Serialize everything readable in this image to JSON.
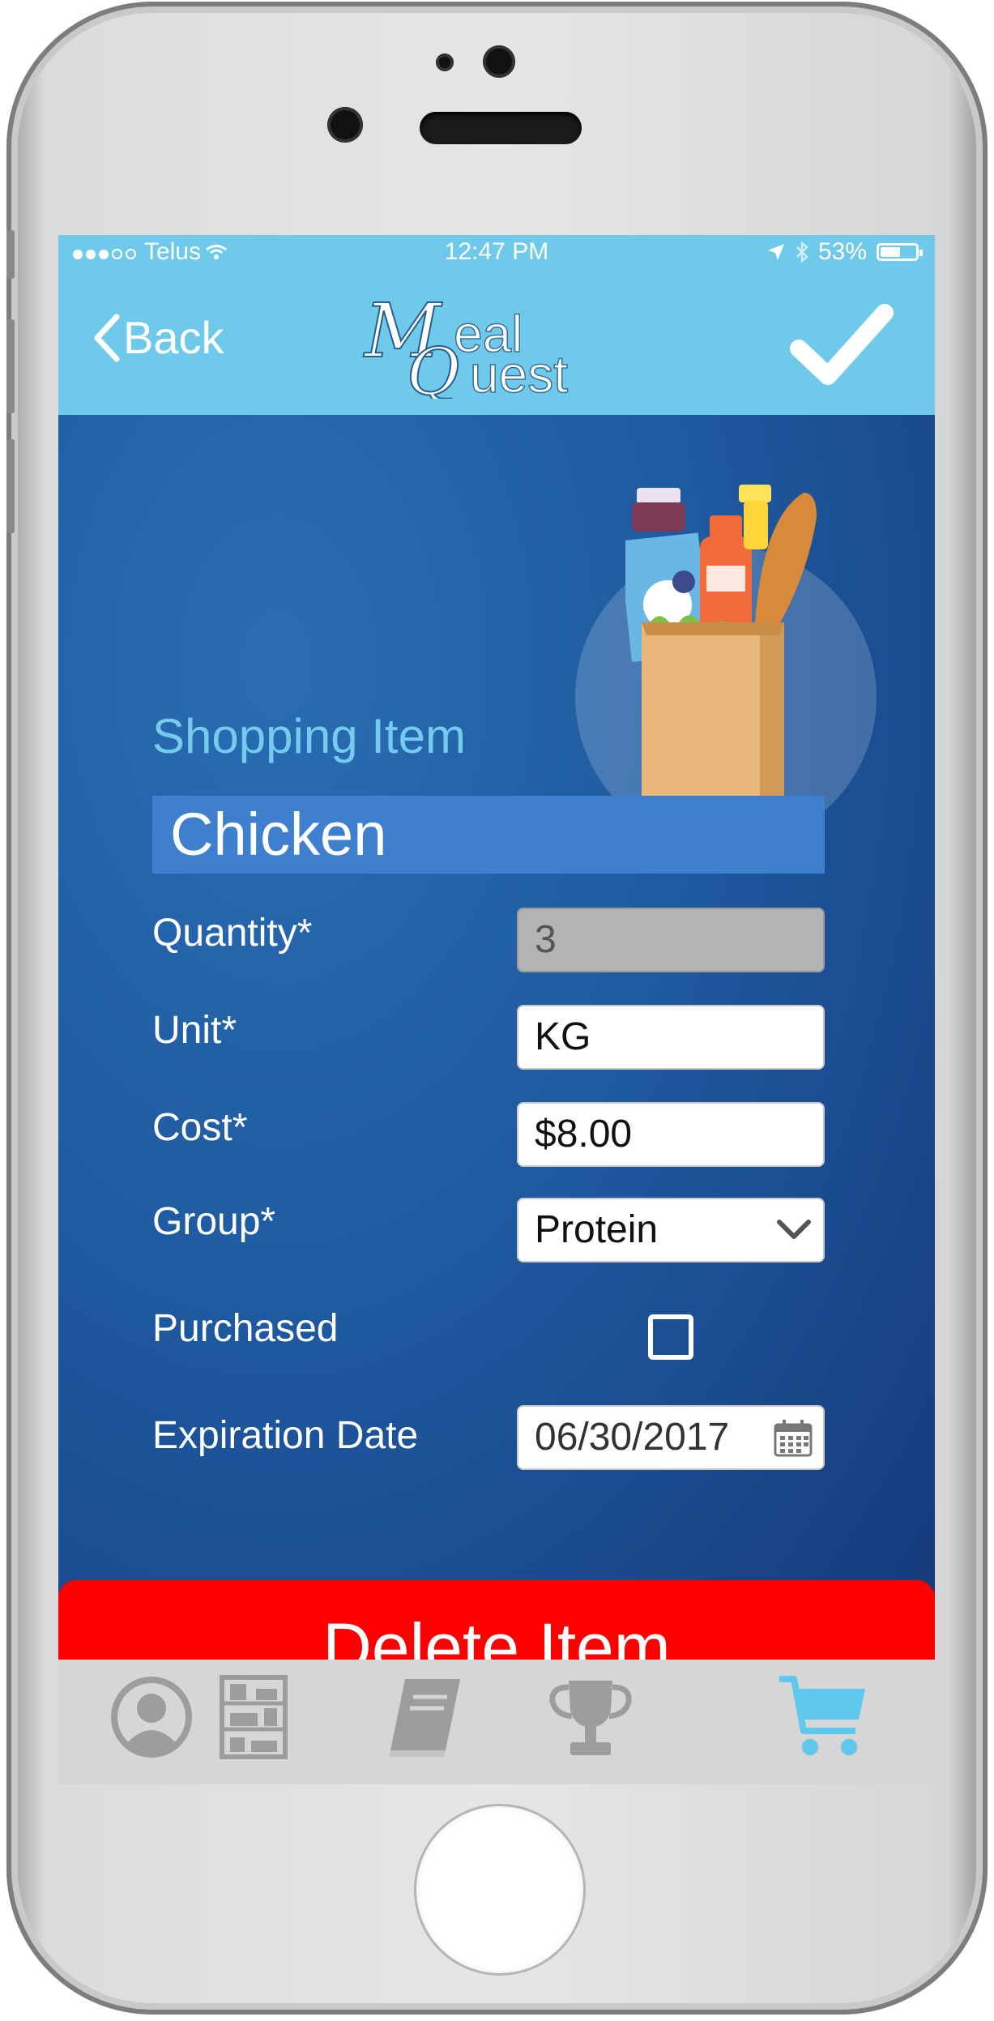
{
  "status_bar": {
    "carrier": "Telus",
    "time": "12:47 PM",
    "battery": "53%"
  },
  "nav": {
    "back_label": "Back",
    "logo_text_top": "eal",
    "logo_text_bottom": "uest",
    "logo_initial_1": "M",
    "logo_initial_2": "Q"
  },
  "form": {
    "section_title": "Shopping Item",
    "item_name": "Chicken",
    "fields": [
      {
        "label": "Quantity*",
        "value": "3"
      },
      {
        "label": "Unit*",
        "value": "KG"
      },
      {
        "label": "Cost*",
        "value": "$8.00"
      },
      {
        "label": "Group*",
        "value": "Protein"
      }
    ],
    "purchased_label": "Purchased",
    "purchased_checked": false,
    "expiration_label": "Expiration Date",
    "expiration_value": "06/30/2017"
  },
  "delete_label": "Delete Item",
  "tab_bar": {
    "tabs": [
      {
        "icon": "profile-icon",
        "active": false
      },
      {
        "icon": "pantry-icon",
        "active": false
      },
      {
        "icon": "recipe-book-icon",
        "active": false
      },
      {
        "icon": "trophy-icon",
        "active": false
      },
      {
        "icon": "shopping-cart-icon",
        "active": true
      }
    ]
  },
  "colors": {
    "header": "#6ec9ea",
    "accent": "#74cbee",
    "delete": "#fe0000",
    "tab_inactive": "#9d9d9d",
    "tab_active": "#5fc8ec"
  }
}
